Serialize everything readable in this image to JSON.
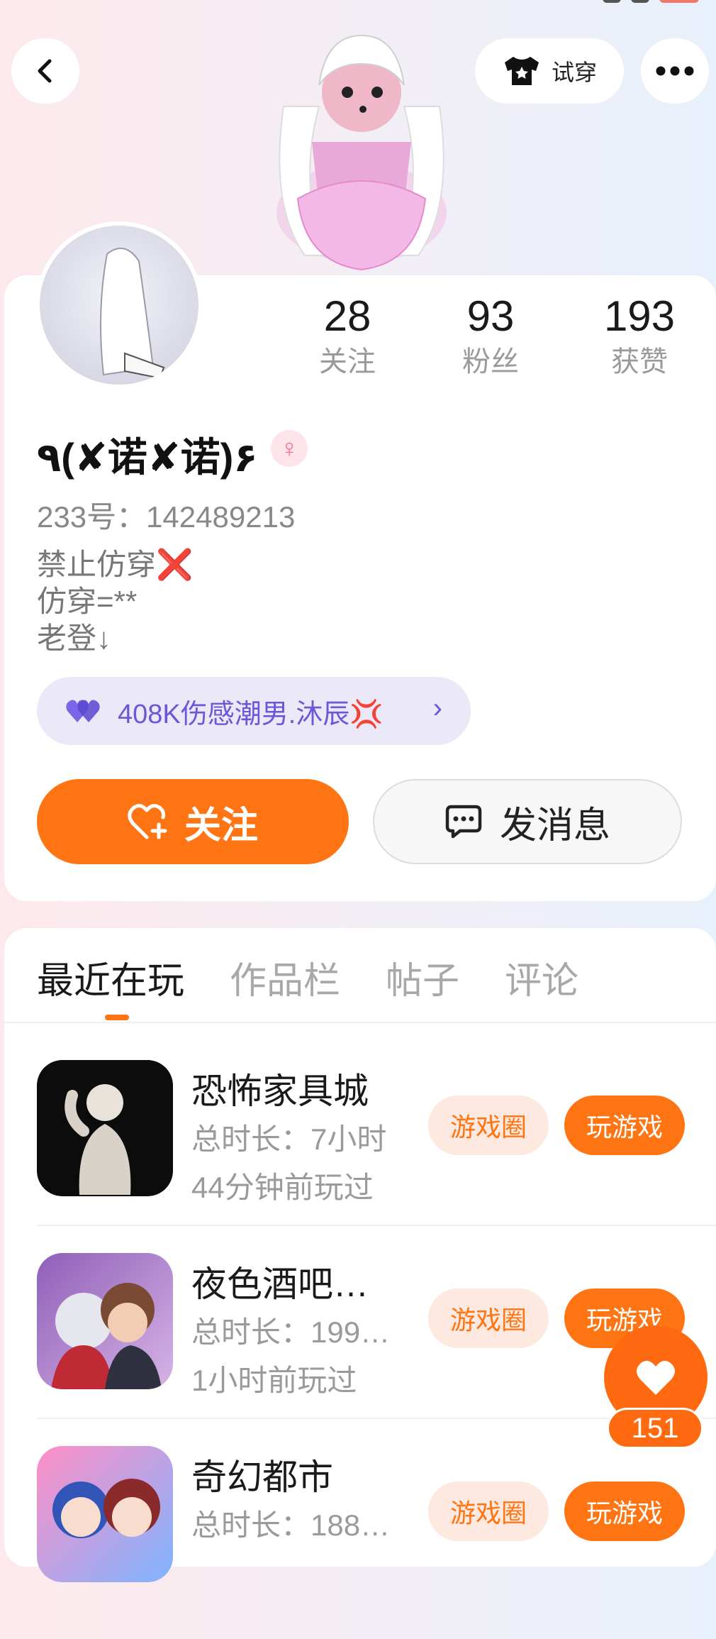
{
  "header": {
    "tryon_label": "试穿"
  },
  "stats": [
    {
      "count": "28",
      "label": "关注"
    },
    {
      "count": "93",
      "label": "粉丝"
    },
    {
      "count": "193",
      "label": "获赞"
    }
  ],
  "profile": {
    "nickname": "٩(✘诺✘诺)۶",
    "gender_symbol": "♀",
    "uid": "233号：142489213",
    "bio": [
      "禁止仿穿❌",
      "仿穿=**",
      "老登↓"
    ],
    "fanclub": "408K伤感潮男.沐辰💢",
    "follow_label": "关注",
    "message_label": "发消息"
  },
  "tabs": [
    {
      "label": "最近在玩",
      "active": true
    },
    {
      "label": "作品栏",
      "active": false
    },
    {
      "label": "帖子",
      "active": false
    },
    {
      "label": "评论",
      "active": false
    }
  ],
  "games": [
    {
      "name": "恐怖家具城",
      "duration": "总时长：7小时",
      "last_played": "44分钟前玩过",
      "circle_label": "游戏圈",
      "play_label": "玩游戏"
    },
    {
      "name": "夜色酒吧…",
      "duration": "总时长：199…",
      "last_played": "1小时前玩过",
      "circle_label": "游戏圈",
      "play_label": "玩游戏"
    },
    {
      "name": "奇幻都市",
      "duration": "总时长：188…",
      "last_played": "",
      "circle_label": "游戏圈",
      "play_label": "玩游戏"
    }
  ],
  "favorite": {
    "count": "151"
  },
  "colors": {
    "accent": "#ff7513",
    "fanclub_bg": "#ebe8f8",
    "fanclub_text": "#6b58d9",
    "gender_pink": "#ff6f91"
  },
  "icons": {
    "back": "chevron-left-icon",
    "tryon": "tshirt-icon",
    "more": "more-dots-icon",
    "follow": "heart-plus-icon",
    "message": "chat-bubble-icon",
    "fanclub": "double-heart-icon",
    "favorite": "heart-icon"
  }
}
